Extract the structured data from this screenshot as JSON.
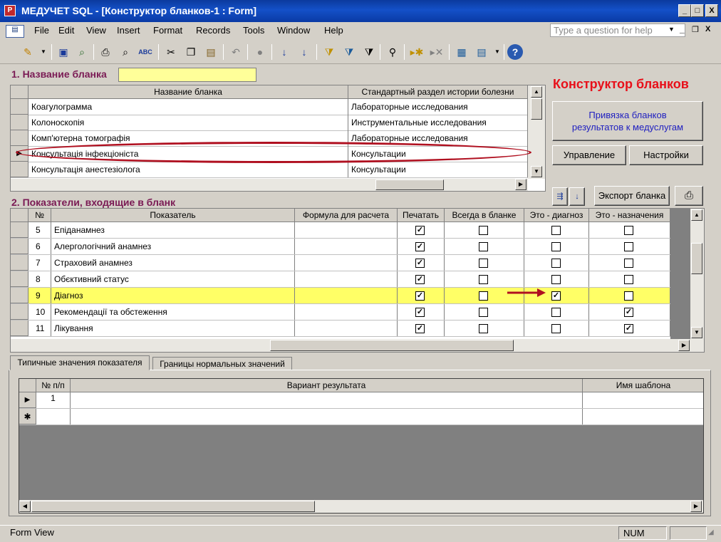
{
  "window": {
    "title": "МЕДУЧЕТ SQL - [Конструктор бланков-1 : Form]",
    "app_icon_letter": "Р",
    "min": "_",
    "max": "□",
    "close": "X"
  },
  "menu": {
    "items": [
      "File",
      "Edit",
      "View",
      "Insert",
      "Format",
      "Records",
      "Tools",
      "Window",
      "Help"
    ],
    "ask_placeholder": "Type a question for help",
    "doc_min": "_",
    "doc_restore": "❐",
    "doc_close": "X"
  },
  "section1": {
    "label": "1. Название бланка",
    "name_value": "",
    "columns": [
      "Название бланка",
      "Стандартный раздел истории болезни"
    ],
    "rows": [
      [
        "Коагулограмма",
        "Лабораторные исследования"
      ],
      [
        "Колоноскопія",
        "Инструментальные исследования"
      ],
      [
        "Комп'ютерна томографія",
        "Лабораторные исследования"
      ],
      [
        "Консультація інфекціоніста",
        "Консультации"
      ],
      [
        "Консультація анестезіолога",
        "Консультации"
      ]
    ],
    "current_row_index": 3
  },
  "right_panel": {
    "title": "Конструктор бланков",
    "title_color": "#e8101a",
    "link_button": "Привязка бланков результатов к медуслугам",
    "manage_button": "Управление",
    "settings_button": "Настройки",
    "export_button": "Экспорт бланка"
  },
  "section2": {
    "label": "2. Показатели, входящие в бланк",
    "columns": [
      "№",
      "Показатель",
      "Формула для расчета",
      "Печатать",
      "Всегда в бланке",
      "Это - диагноз",
      "Это - назначения"
    ],
    "rows": [
      {
        "num": "5",
        "name": "Епіданамнез",
        "formula": "",
        "print": true,
        "always": false,
        "diag": false,
        "assign": false
      },
      {
        "num": "6",
        "name": "Алергологічний анамнез",
        "formula": "",
        "print": true,
        "always": false,
        "diag": false,
        "assign": false
      },
      {
        "num": "7",
        "name": "Страховий анамнез",
        "formula": "",
        "print": true,
        "always": false,
        "diag": false,
        "assign": false
      },
      {
        "num": "8",
        "name": "Обєктивний статус",
        "formula": "",
        "print": true,
        "always": false,
        "diag": false,
        "assign": false
      },
      {
        "num": "9",
        "name": "Діагноз",
        "formula": "",
        "print": true,
        "always": false,
        "diag": true,
        "assign": false
      },
      {
        "num": "10",
        "name": "Рекомендації та обстеження",
        "formula": "",
        "print": true,
        "always": false,
        "diag": false,
        "assign": true
      },
      {
        "num": "11",
        "name": "Лікування",
        "formula": "",
        "print": true,
        "always": false,
        "diag": false,
        "assign": true
      }
    ],
    "highlight_row_index": 4,
    "highlight_color": "#ffff66"
  },
  "tabs": {
    "items": [
      "Типичные значения показателя",
      "Границы нормальных значений"
    ],
    "active_index": 0
  },
  "subgrid": {
    "columns": [
      "№ п/п",
      "Вариант результата",
      "Имя шаблона"
    ],
    "rows": [
      {
        "num": "1",
        "variant": "",
        "template": ""
      }
    ],
    "new_row_marker": "✱",
    "current_marker": "▶"
  },
  "status": {
    "left": "Form View",
    "num": "NUM"
  }
}
